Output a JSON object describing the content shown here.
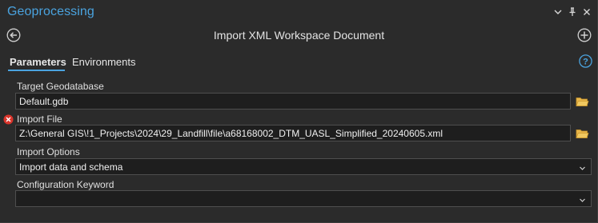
{
  "pane": {
    "title": "Geoprocessing",
    "controls": {
      "menu": "▾",
      "pin": "⊥",
      "close": "✕"
    }
  },
  "tool": {
    "title": "Import XML Workspace Document",
    "back_icon": "back-arrow-icon",
    "add_icon": "add-icon"
  },
  "tabs": [
    {
      "label": "Parameters",
      "active": true
    },
    {
      "label": "Environments",
      "active": false
    }
  ],
  "help_icon": "help-icon",
  "params": {
    "target_gdb": {
      "label": "Target Geodatabase",
      "value": "Default.gdb"
    },
    "import_file": {
      "label": "Import File",
      "value": "Z:\\General GIS\\!1_Projects\\2024\\29_Landfill\\file\\a68168002_DTM_UASL_Simplified_20240605.xml",
      "error": true
    },
    "import_options": {
      "label": "Import Options",
      "value": "Import data and schema"
    },
    "config_keyword": {
      "label": "Configuration Keyword",
      "value": ""
    }
  },
  "colors": {
    "accent": "#4aa3df",
    "background": "#2b2b2b",
    "field_bg": "#1e1e1e",
    "error": "#d9342b",
    "folder": "#e8b64a"
  }
}
